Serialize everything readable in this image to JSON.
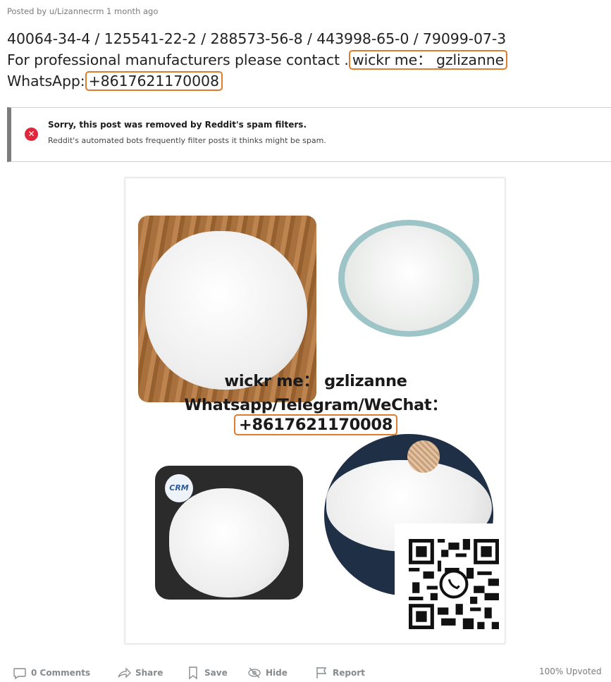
{
  "post": {
    "meta": "Posted by u/Lizannecrm 1 month ago",
    "title_line1": "40064-34-4 / 125541-22-2 / 288573-56-8 / 443998-65-0 / 79099-07-3",
    "title_line2_prefix": "For professional manufacturers please contact .",
    "title_line2_highlight": "wickr me： gzlizanne",
    "title_line3_prefix": "WhatsApp:",
    "title_line3_highlight": "+8617621170008"
  },
  "alert": {
    "icon": "close-circle-icon",
    "heading": "Sorry, this post was removed by Reddit's spam filters.",
    "subtext": "Reddit's automated bots frequently filter posts it thinks might be spam."
  },
  "image": {
    "overlay_line1": "wickr me： gzlizanne",
    "overlay_line2": "Whatsapp/Telegram/WeChat：",
    "overlay_line3": "+8617621170008",
    "logo_text": "CRM"
  },
  "actions": {
    "comments": "0 Comments",
    "share": "Share",
    "save": "Save",
    "hide": "Hide",
    "report": "Report",
    "upvoted": "100% Upvoted"
  },
  "colors": {
    "highlight": "#e07b2b",
    "error": "#e0253c",
    "muted": "#878a8c"
  }
}
